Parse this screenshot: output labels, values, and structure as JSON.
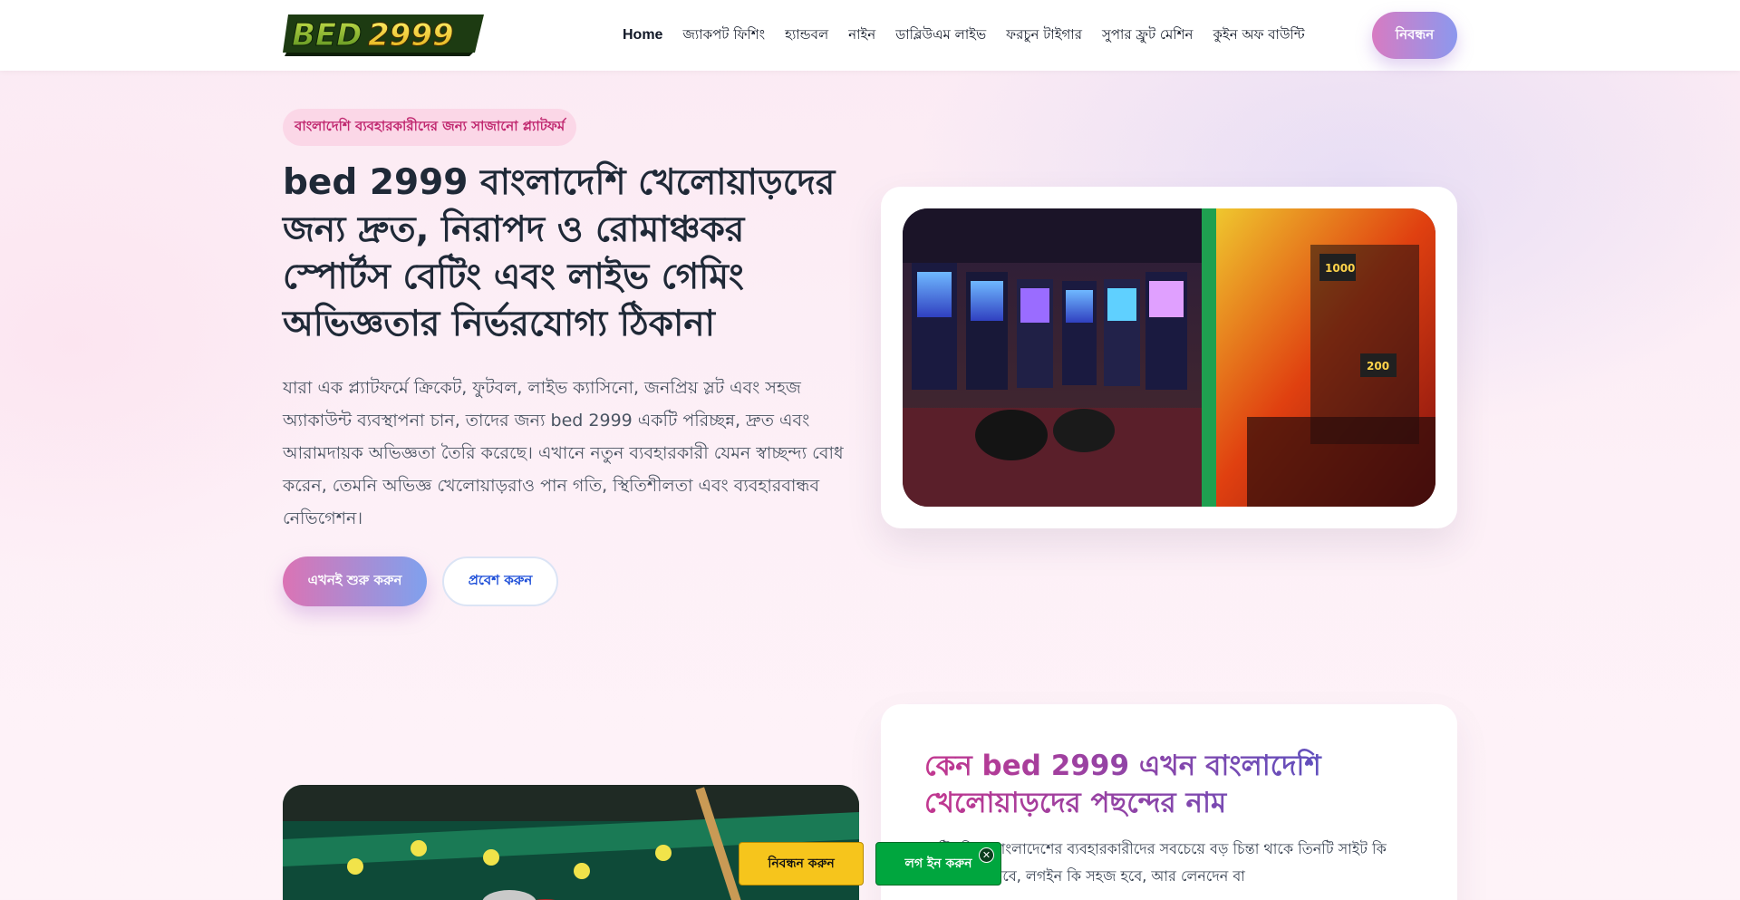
{
  "header": {
    "logo_text": "BED2999",
    "nav": [
      "Home",
      "জ্যাকপট ফিশিং",
      "হ্যান্ডবল",
      "নাইন",
      "ডাব্লিউএম লাইভ",
      "ফরচুন টাইগার",
      "সুপার ফ্রুট মেশিন",
      "কুইন অফ বাউন্টি"
    ],
    "register_label": "নিবন্ধন"
  },
  "hero": {
    "badge": "বাংলাদেশি ব্যবহারকারীদের জন্য সাজানো প্ল্যাটফর্ম",
    "title": "bed 2999 বাংলাদেশি খেলোয়াড়দের জন্য দ্রুত, নিরাপদ ও রোমাঞ্চকর স্পোর্টস বেটিং এবং লাইভ গেমিং অভিজ্ঞতার নির্ভরযোগ্য ঠিকানা",
    "description": "যারা এক প্ল্যাটফর্মে ক্রিকেট, ফুটবল, লাইভ ক্যাসিনো, জনপ্রিয় স্লট এবং সহজ অ্যাকাউন্ট ব্যবস্থাপনা চান, তাদের জন্য bed 2999 একটি পরিচ্ছন্ন, দ্রুত এবং আরামদায়ক অভিজ্ঞতা তৈরি করেছে। এখানে নতুন ব্যবহারকারী যেমন স্বাচ্ছন্দ্য বোধ করেন, তেমনি অভিজ্ঞ খেলোয়াড়রাও পান গতি, স্থিতিশীলতা এবং ব্যবহারবান্ধব নেভিগেশন।",
    "cta_primary": "এখনই শুরু করুন",
    "cta_secondary": "প্রবেশ করুন"
  },
  "section": {
    "title": "কেন bed 2999 এখন বাংলাদেশি খেলোয়াড়দের পছন্দের নাম",
    "text": "বেটিং নিয়ে বাংলাদেশের ব্যবহারকারীদের সবচেয়ে বড় চিন্তা থাকে তিনটি সাইট কি দ্রুত কাজ করবে, লগইন কি সহজ হবে, আর লেনদেন বা"
  },
  "floating": {
    "register_label": "নিবন্ধন করুন",
    "login_label": "লগ ইন করুন",
    "close_symbol": "✕"
  },
  "colors": {
    "accent_pink": "#d77bc2",
    "accent_blue": "#8c98ee",
    "badge_text": "#c0276f",
    "float_yellow": "#f6c51c",
    "float_green": "#00a63e"
  }
}
